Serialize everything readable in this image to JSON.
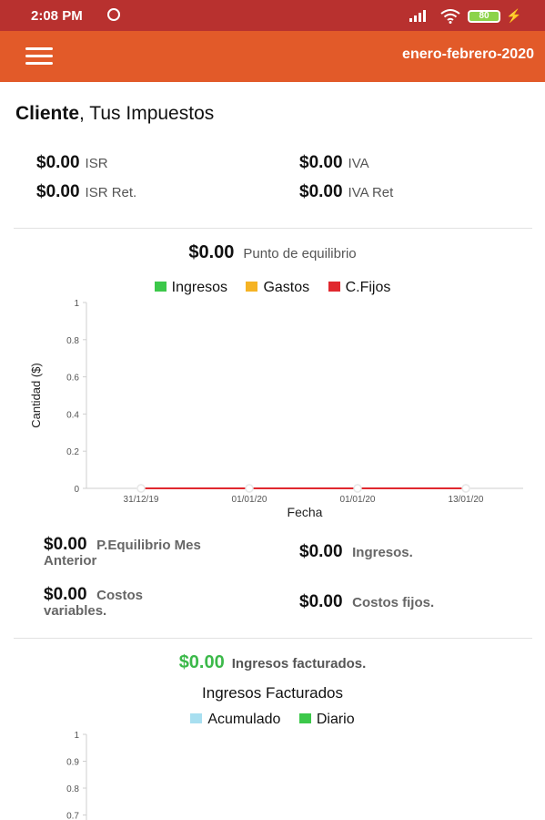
{
  "status_bar": {
    "time": "2:08 PM",
    "battery": "80"
  },
  "app_bar": {
    "period": "enero-febrero-2020"
  },
  "header": {
    "title_bold": "Cliente",
    "title_rest": ", Tus Impuestos"
  },
  "taxes": [
    {
      "value": "$0.00",
      "label": "ISR"
    },
    {
      "value": "$0.00",
      "label": "IVA"
    },
    {
      "value": "$0.00",
      "label": "ISR Ret."
    },
    {
      "value": "$0.00",
      "label": "IVA Ret"
    }
  ],
  "breakeven": {
    "value": "$0.00",
    "label": "Punto de equilibrio"
  },
  "chart_data": [
    {
      "type": "line",
      "legend": [
        {
          "name": "Ingresos",
          "color": "#3cc84a"
        },
        {
          "name": "Gastos",
          "color": "#f5b324"
        },
        {
          "name": "C.Fijos",
          "color": "#e0282e"
        }
      ],
      "xlabel": "Fecha",
      "ylabel": "Cantidad ($)",
      "x": [
        "31/12/19",
        "01/01/20",
        "01/01/20",
        "13/01/20"
      ],
      "y_ticks": [
        "0",
        "0.2",
        "0.4",
        "0.6",
        "0.8",
        "1"
      ],
      "ylim": [
        0,
        1
      ],
      "series": [
        {
          "name": "Ingresos",
          "color": "#3cc84a",
          "values": [
            0,
            0,
            0,
            0
          ]
        },
        {
          "name": "Gastos",
          "color": "#f5b324",
          "values": [
            0,
            0,
            0,
            0
          ]
        },
        {
          "name": "C.Fijos",
          "color": "#e0282e",
          "values": [
            0,
            0,
            0,
            0
          ]
        }
      ],
      "legend_position": "top"
    },
    {
      "type": "line",
      "title": "Ingresos Facturados",
      "legend": [
        {
          "name": "Acumulado",
          "color": "#a8dff0"
        },
        {
          "name": "Diario",
          "color": "#3cc84a"
        }
      ],
      "y_ticks": [
        "0.7",
        "0.8",
        "0.9",
        "1"
      ],
      "legend_position": "top"
    }
  ],
  "stats": {
    "prev_value": "$0.00",
    "prev_label_1": "P.Equilibrio Mes",
    "prev_label_2": "Anterior",
    "ingresos_value": "$0.00",
    "ingresos_label": "Ingresos.",
    "var_value": "$0.00",
    "var_label_1": "Costos",
    "var_label_2": "variables.",
    "fijos_value": "$0.00",
    "fijos_label": "Costos fijos."
  },
  "invoiced": {
    "value": "$0.00",
    "label": "Ingresos facturados."
  }
}
